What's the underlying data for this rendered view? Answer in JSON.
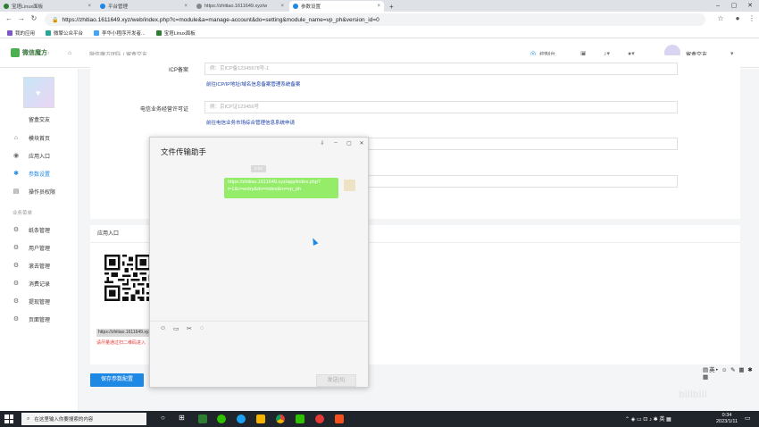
{
  "browser": {
    "tabs": [
      {
        "label": "宝塔Linux面板",
        "active": false,
        "color": "#2e7d32"
      },
      {
        "label": "平台管理",
        "active": false,
        "color": "#1e88e5"
      },
      {
        "label": "https://zhitiao.1611649.xyz/w",
        "active": false,
        "color": "#888888"
      },
      {
        "label": "参数设置",
        "active": true,
        "color": "#1e88e5"
      }
    ],
    "new_tab": "+",
    "url": "https://zhitiao.1611649.xyz/web/index.php?c=module&a=manage-account&do=setting&module_name=vp_ph&version_id=0",
    "bookmarks": [
      {
        "label": "我的应用",
        "color": "#7e57c2"
      },
      {
        "label": "微擎公众平台",
        "color": "#26a69a"
      },
      {
        "label": "李华小程序开发者...",
        "color": "#42a5f5"
      },
      {
        "label": "宝塔Linux面板",
        "color": "#2e7d32"
      }
    ]
  },
  "app": {
    "logo": "微信魔方",
    "logo_sup": "7",
    "breadcrumb": "微信魔方团队 / 留盒交友",
    "header_console": "控制台",
    "user_name": "留盒交友"
  },
  "sidebar": {
    "account_name": "留盒交友",
    "items": [
      {
        "label": "模块首页",
        "icon": "home-icon",
        "glyph": "⌂",
        "active": false
      },
      {
        "label": "应用入口",
        "icon": "chat-icon",
        "glyph": "◉",
        "active": false
      },
      {
        "label": "参数设置",
        "icon": "settings-icon",
        "glyph": "✱",
        "active": true
      },
      {
        "label": "操作员权限",
        "icon": "document-icon",
        "glyph": "▤",
        "active": false
      }
    ],
    "group_label": "业务菜单",
    "group_items": [
      {
        "label": "纸条管理",
        "icon": "gear-icon",
        "glyph": "⚙"
      },
      {
        "label": "用户管理",
        "icon": "gear-icon",
        "glyph": "⚙"
      },
      {
        "label": "滚去管理",
        "icon": "gear-icon",
        "glyph": "⚙"
      },
      {
        "label": "消费记录",
        "icon": "gear-icon",
        "glyph": "⚙"
      },
      {
        "label": "提现管理",
        "icon": "gear-icon",
        "glyph": "⚙"
      },
      {
        "label": "页面管理",
        "icon": "gear-icon",
        "glyph": "⚙"
      }
    ]
  },
  "form": {
    "icp_label": "ICP备案",
    "icp_placeholder": "例：京ICP备12345678号-1",
    "icp_link": "前往ICP/IP地址/域名信息备案管理系统备案",
    "permit_label": "电信业务经营许可证",
    "permit_placeholder": "例：京ICP证123456号",
    "permit_link": "前往电信业务市场综合管理信息系统申请"
  },
  "entry": {
    "title": "应用入口",
    "url_text": "https://zhitiao.1611649.xyz",
    "scan_hint": "请尽量通过扫二维码进入"
  },
  "save_button": "保存参数配置",
  "dialog": {
    "title": "文件传输助手",
    "time": "0:34",
    "message": "https://zhitiao.1611649.xyz/app/index.php?i=1&c=entry&do=index&m=vp_ph",
    "send": "发送(S)"
  },
  "ime": "英",
  "taskbar": {
    "search_placeholder": "在这里输入你要搜索的内容",
    "tray_lang": "英",
    "time": "0:34",
    "date": "2023/1/11"
  },
  "colors": {
    "accent": "#1e88e5",
    "bubble": "#95ec69",
    "link": "#1a3fa8",
    "warning": "#e53935"
  }
}
